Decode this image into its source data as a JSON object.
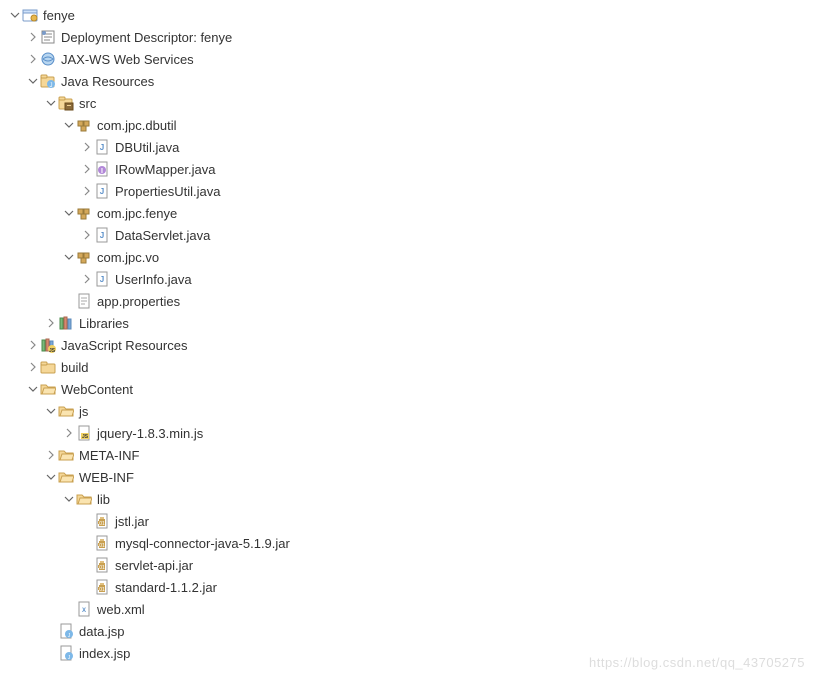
{
  "watermark": "https://blog.csdn.net/qq_43705275",
  "tree": [
    {
      "indent": 0,
      "arrow": "down",
      "icon": "project",
      "label": "fenye"
    },
    {
      "indent": 1,
      "arrow": "right",
      "icon": "deploy-desc",
      "label": "Deployment Descriptor: fenye"
    },
    {
      "indent": 1,
      "arrow": "right",
      "icon": "jaxws",
      "label": "JAX-WS Web Services"
    },
    {
      "indent": 1,
      "arrow": "down",
      "icon": "java-resources",
      "label": "Java Resources"
    },
    {
      "indent": 2,
      "arrow": "down",
      "icon": "src-folder",
      "label": "src"
    },
    {
      "indent": 3,
      "arrow": "down",
      "icon": "package",
      "label": "com.jpc.dbutil"
    },
    {
      "indent": 4,
      "arrow": "right",
      "icon": "java-file",
      "label": "DBUtil.java"
    },
    {
      "indent": 4,
      "arrow": "right",
      "icon": "java-interface",
      "label": "IRowMapper.java"
    },
    {
      "indent": 4,
      "arrow": "right",
      "icon": "java-file",
      "label": "PropertiesUtil.java"
    },
    {
      "indent": 3,
      "arrow": "down",
      "icon": "package",
      "label": "com.jpc.fenye"
    },
    {
      "indent": 4,
      "arrow": "right",
      "icon": "java-file",
      "label": "DataServlet.java"
    },
    {
      "indent": 3,
      "arrow": "down",
      "icon": "package",
      "label": "com.jpc.vo"
    },
    {
      "indent": 4,
      "arrow": "right",
      "icon": "java-file",
      "label": "UserInfo.java"
    },
    {
      "indent": 3,
      "arrow": "none",
      "icon": "props-file",
      "label": "app.properties"
    },
    {
      "indent": 2,
      "arrow": "right",
      "icon": "libraries",
      "label": "Libraries"
    },
    {
      "indent": 1,
      "arrow": "right",
      "icon": "js-resources",
      "label": "JavaScript Resources"
    },
    {
      "indent": 1,
      "arrow": "right",
      "icon": "folder",
      "label": "build"
    },
    {
      "indent": 1,
      "arrow": "down",
      "icon": "folder-open",
      "label": "WebContent"
    },
    {
      "indent": 2,
      "arrow": "down",
      "icon": "folder-open",
      "label": "js"
    },
    {
      "indent": 3,
      "arrow": "right",
      "icon": "js-file",
      "label": "jquery-1.8.3.min.js"
    },
    {
      "indent": 2,
      "arrow": "right",
      "icon": "folder-open",
      "label": "META-INF"
    },
    {
      "indent": 2,
      "arrow": "down",
      "icon": "folder-open",
      "label": "WEB-INF"
    },
    {
      "indent": 3,
      "arrow": "down",
      "icon": "folder-open",
      "label": "lib"
    },
    {
      "indent": 4,
      "arrow": "none",
      "icon": "jar-file",
      "label": "jstl.jar"
    },
    {
      "indent": 4,
      "arrow": "none",
      "icon": "jar-file",
      "label": "mysql-connector-java-5.1.9.jar"
    },
    {
      "indent": 4,
      "arrow": "none",
      "icon": "jar-file",
      "label": "servlet-api.jar"
    },
    {
      "indent": 4,
      "arrow": "none",
      "icon": "jar-file",
      "label": "standard-1.1.2.jar"
    },
    {
      "indent": 3,
      "arrow": "none",
      "icon": "xml-file",
      "label": "web.xml"
    },
    {
      "indent": 2,
      "arrow": "none",
      "icon": "jsp-file",
      "label": "data.jsp"
    },
    {
      "indent": 2,
      "arrow": "none",
      "icon": "jsp-file",
      "label": "index.jsp"
    }
  ]
}
